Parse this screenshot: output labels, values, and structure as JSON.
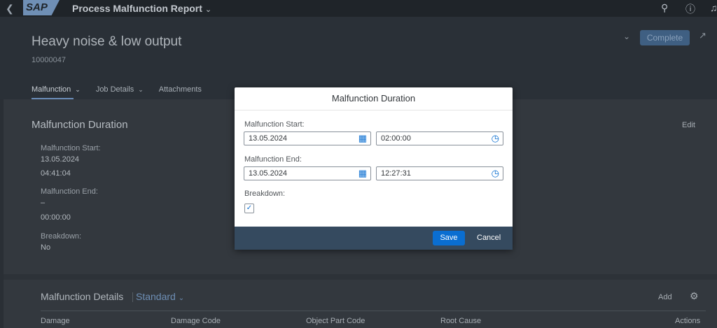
{
  "shell": {
    "app_title": "Process Malfunction Report",
    "logo_text": "SAP"
  },
  "header": {
    "title": "Heavy noise & low output",
    "id": "10000047",
    "complete_label": "Complete"
  },
  "tabs": [
    {
      "label": "Malfunction"
    },
    {
      "label": "Job Details"
    },
    {
      "label": "Attachments"
    }
  ],
  "section": {
    "title": "Malfunction Duration",
    "edit_label": "Edit",
    "start_label": "Malfunction Start:",
    "start_date": "13.05.2024",
    "start_time": "04:41:04",
    "end_label": "Malfunction End:",
    "end_date": "–",
    "end_time": "00:00:00",
    "breakdown_label": "Breakdown:",
    "breakdown_value": "No"
  },
  "details": {
    "title": "Malfunction Details",
    "variant": "Standard",
    "add_label": "Add",
    "columns": [
      "Damage",
      "Damage Code",
      "Object Part Code",
      "Root Cause",
      "Actions"
    ]
  },
  "dialog": {
    "title": "Malfunction Duration",
    "start_label": "Malfunction Start:",
    "start_date": "13.05.2024",
    "start_time": "02:00:00",
    "end_label": "Malfunction End:",
    "end_date": "13.05.2024",
    "end_time": "12:27:31",
    "breakdown_label": "Breakdown:",
    "breakdown_checked": true,
    "save_label": "Save",
    "cancel_label": "Cancel"
  }
}
